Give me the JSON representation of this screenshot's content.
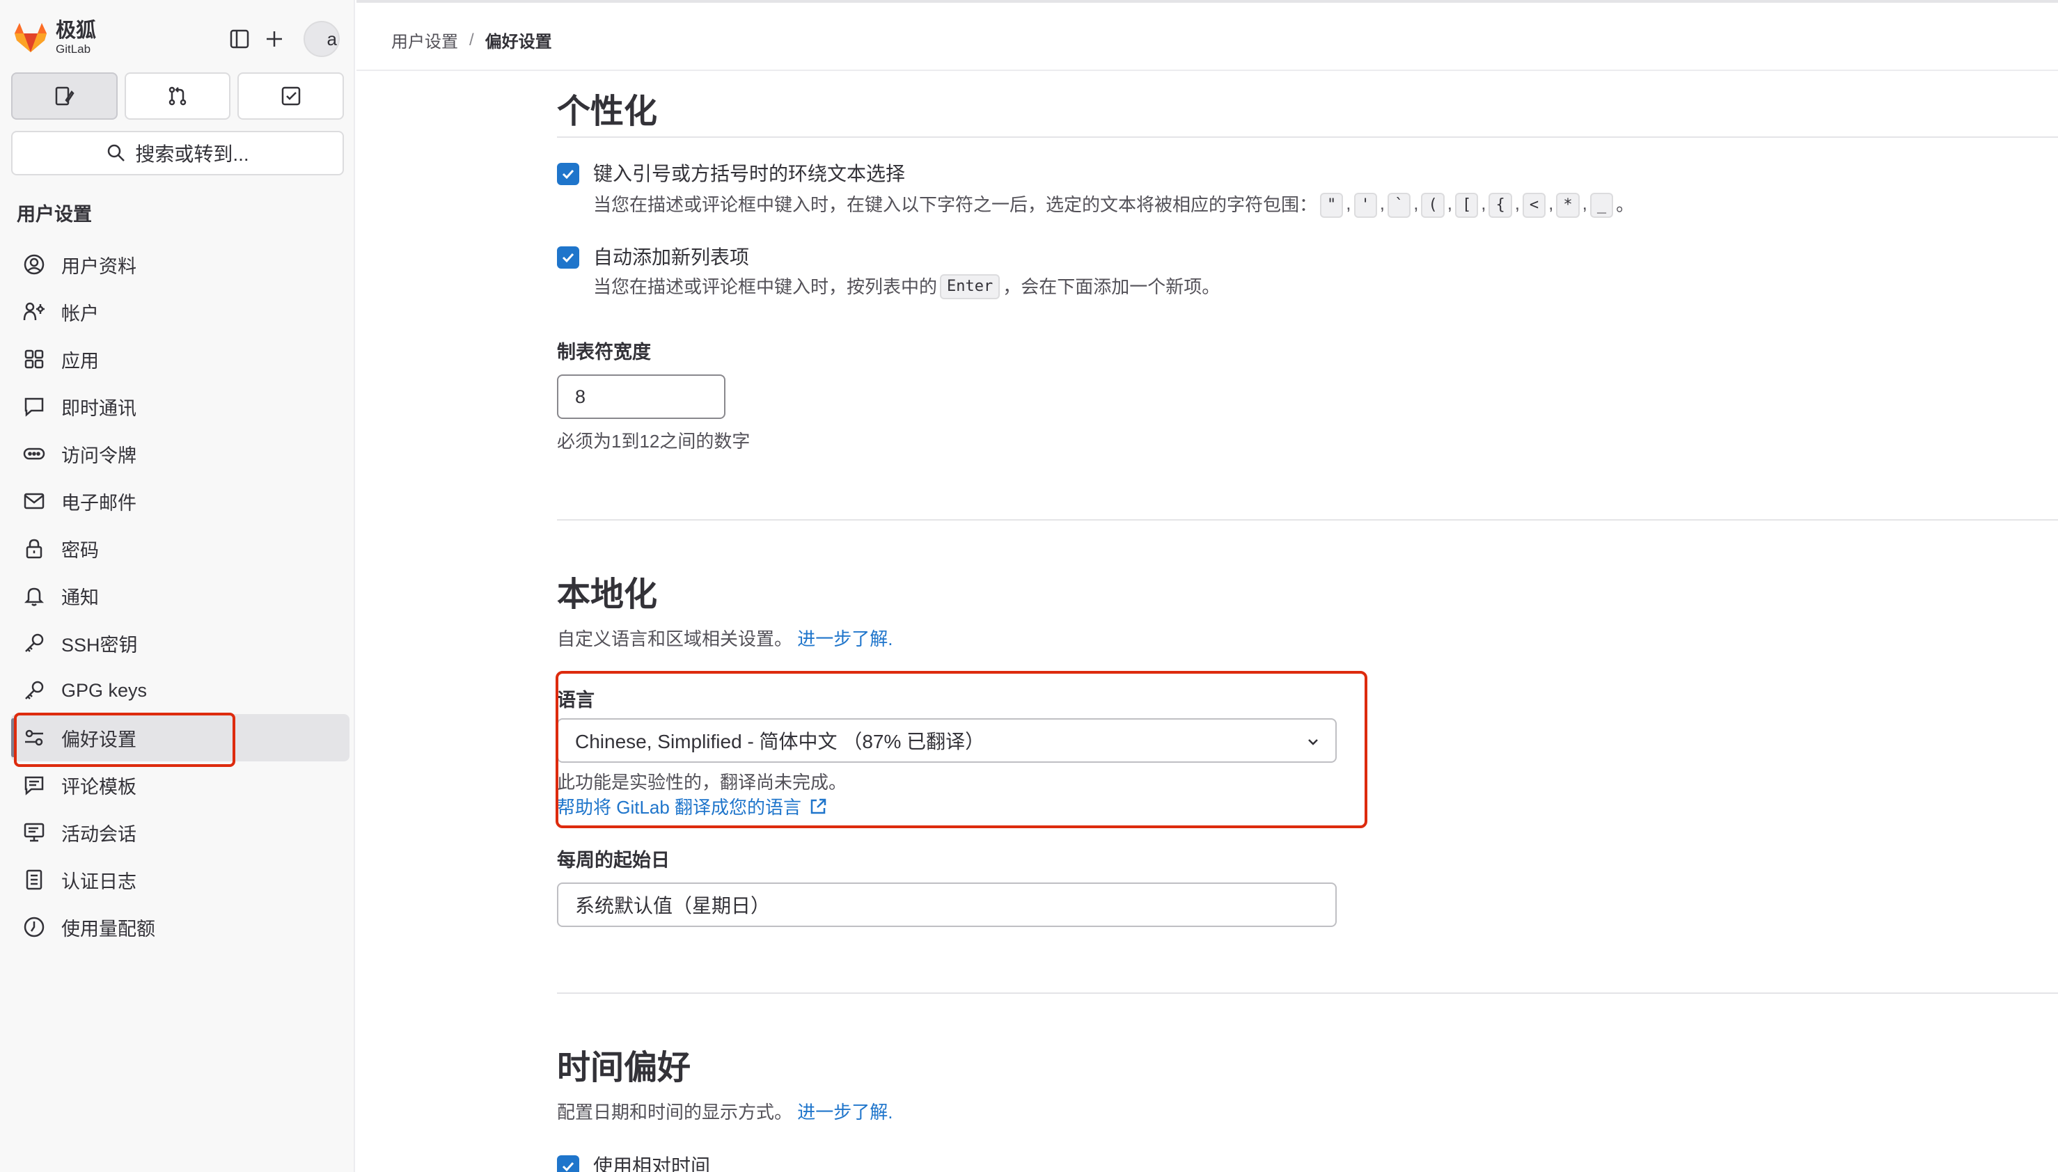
{
  "brand": {
    "name_cn": "极狐",
    "name_en": "GitLab",
    "accent": "#fc6d26"
  },
  "avatar": {
    "alt_text": "a"
  },
  "nav_tabs": [
    {
      "name": "issues",
      "icon": "issues-icon"
    },
    {
      "name": "merge-requests",
      "icon": "merge-request-icon"
    },
    {
      "name": "todos",
      "icon": "todo-icon"
    }
  ],
  "search": {
    "label": "搜索或转到..."
  },
  "sidebar": {
    "section_title": "用户设置",
    "items": [
      {
        "label": "用户资料",
        "icon": "profile-icon"
      },
      {
        "label": "帐户",
        "icon": "account-icon"
      },
      {
        "label": "应用",
        "icon": "applications-icon"
      },
      {
        "label": "即时通讯",
        "icon": "chat-icon"
      },
      {
        "label": "访问令牌",
        "icon": "token-icon"
      },
      {
        "label": "电子邮件",
        "icon": "mail-icon"
      },
      {
        "label": "密码",
        "icon": "lock-icon"
      },
      {
        "label": "通知",
        "icon": "bell-icon"
      },
      {
        "label": "SSH密钥",
        "icon": "key-icon"
      },
      {
        "label": "GPG keys",
        "icon": "key-icon"
      },
      {
        "label": "偏好设置",
        "icon": "preferences-icon",
        "active": true
      },
      {
        "label": "评论模板",
        "icon": "comment-template-icon"
      },
      {
        "label": "活动会话",
        "icon": "sessions-icon"
      },
      {
        "label": "认证日志",
        "icon": "log-icon"
      },
      {
        "label": "使用量配额",
        "icon": "usage-quota-icon"
      }
    ]
  },
  "breadcrumb": {
    "parent": "用户设置",
    "separator": "/",
    "current": "偏好设置"
  },
  "personalization": {
    "title": "个性化",
    "surround_selection": {
      "checked": true,
      "label": "键入引号或方括号时的环绕文本选择",
      "help_prefix": "当您在描述或评论框中键入时，在键入以下字符之一后，选定的文本将被相应的字符包围：",
      "chars": [
        "\"",
        "'",
        "`",
        "(",
        "[",
        "{",
        "<",
        "*",
        "_"
      ],
      "char_sep": ",",
      "help_suffix": "。"
    },
    "auto_list": {
      "checked": true,
      "label": "自动添加新列表项",
      "help_prefix": "当您在描述或评论框中键入时，按列表中的",
      "key": "Enter",
      "help_suffix": "，会在下面添加一个新项。"
    },
    "tab_width": {
      "label": "制表符宽度",
      "value": "8",
      "help": "必须为1到12之间的数字"
    }
  },
  "localization": {
    "title": "本地化",
    "description": "自定义语言和区域相关设置。",
    "learn_more": "进一步了解.",
    "language": {
      "label": "语言",
      "selected": "Chinese, Simplified - 简体中文 （87% 已翻译）",
      "note": "此功能是实验性的，翻译尚未完成。",
      "help_link": "帮助将 GitLab 翻译成您的语言"
    },
    "first_day": {
      "label": "每周的起始日",
      "selected": "系统默认值（星期日）"
    }
  },
  "time_preferences": {
    "title": "时间偏好",
    "description": "配置日期和时间的显示方式。",
    "learn_more": "进一步了解.",
    "relative_time": {
      "checked": true,
      "label": "使用相对时间"
    }
  },
  "colors": {
    "link": "#1f75cb",
    "checkbox": "#1f75cb",
    "highlight": "#dd2b0e"
  }
}
